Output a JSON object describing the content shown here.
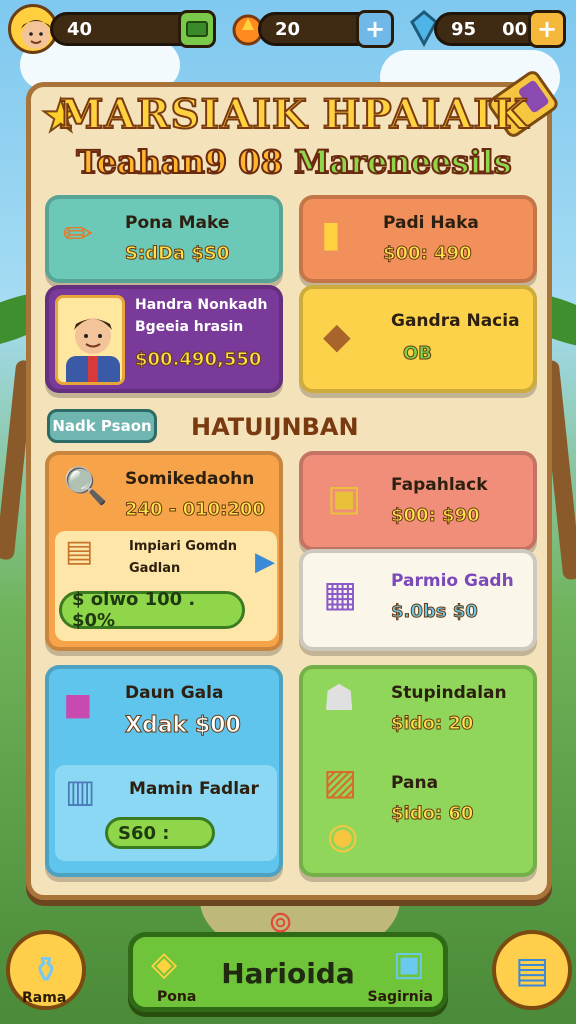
{
  "topbar": {
    "player_count": "40",
    "coins": "20",
    "gems": "95",
    "extra": "00"
  },
  "title": {
    "line1": "MARSIAIK HPAIAIK",
    "line2_a": "Teahan9 08",
    "line2_b": "Mareneesils"
  },
  "cards": {
    "c1": {
      "title": "Pona Make",
      "price": "S:dDa $S0"
    },
    "c2": {
      "title": "Padi Haka",
      "price": "$00: 490"
    },
    "c3": {
      "title": "Handra Nonkadh Bgeeia hrasin",
      "title_a": "Handra Nonkadh",
      "title_b": "Bgeeia hrasin",
      "price": "$00.490,550"
    },
    "c4": {
      "title": "Gandra Nacia",
      "price": "OB"
    },
    "c5": {
      "title": "Somikedaohn",
      "price": "240 - 010:200"
    },
    "c6": {
      "title": "Fapahlack",
      "price": "$00: $90"
    },
    "c7": {
      "title_a": "Impiari Gomdn",
      "title_b": "Gadlan",
      "progress": "$ olwo 100 . $0%"
    },
    "c8": {
      "title": "Parmio Gadh",
      "price": "$.0bs $0"
    },
    "c9": {
      "title": "Daun Gala",
      "price": "Xdak $00"
    },
    "c10": {
      "title": "Stupindalan",
      "price": "$ido: 20"
    },
    "c11": {
      "title": "Mamin Fadlar",
      "progress": "S60 :"
    },
    "c12": {
      "title": "Pana",
      "price": "$ido: 60"
    }
  },
  "section": {
    "tag": "Nadk Psaon",
    "heading": "HATUIJNBAN"
  },
  "bottom": {
    "left_label": "Rama",
    "main_label": "Harioida",
    "main_left_sub": "Pona",
    "main_right_sub": "Sagirnia",
    "right_label": ""
  }
}
